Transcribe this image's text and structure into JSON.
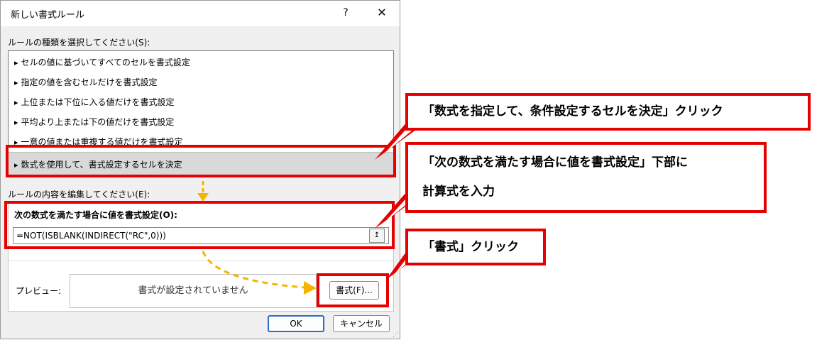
{
  "dialog": {
    "title": "新しい書式ルール",
    "help_label": "?",
    "close_label": "✕"
  },
  "rule_type": {
    "label": "ルールの種類を選択してください(S):",
    "items": [
      "セルの値に基づいてすべてのセルを書式設定",
      "指定の値を含むセルだけを書式設定",
      "上位または下位に入る値だけを書式設定",
      "平均より上または下の値だけを書式設定",
      "一意の値または重複する値だけを書式設定",
      "数式を使用して、書式設定するセルを決定"
    ],
    "selected_index": 5,
    "arrow": "▸"
  },
  "rule_edit": {
    "label": "ルールの内容を編集してください(E):",
    "formula_label": "次の数式を満たす場合に値を書式設定(O):",
    "formula_value": "=NOT(ISBLANK(INDIRECT(\"RC\",0)))",
    "collapse_icon": "↥",
    "preview_label": "プレビュー:",
    "preview_text": "書式が設定されていません",
    "format_button": "書式(F)..."
  },
  "buttons": {
    "ok": "OK",
    "cancel": "キャンセル"
  },
  "callouts": {
    "select_rule": "「数式を指定して、条件設定するセルを決定」クリック",
    "enter_formula_line1": "「次の数式を満たす場合に値を書式設定」下部に",
    "enter_formula_line2": "計算式を入力",
    "click_format": "「書式」クリック"
  },
  "colors": {
    "highlight_red": "#e60000",
    "arrow_yellow": "#f5b400",
    "ok_border": "#2d6cc4"
  }
}
